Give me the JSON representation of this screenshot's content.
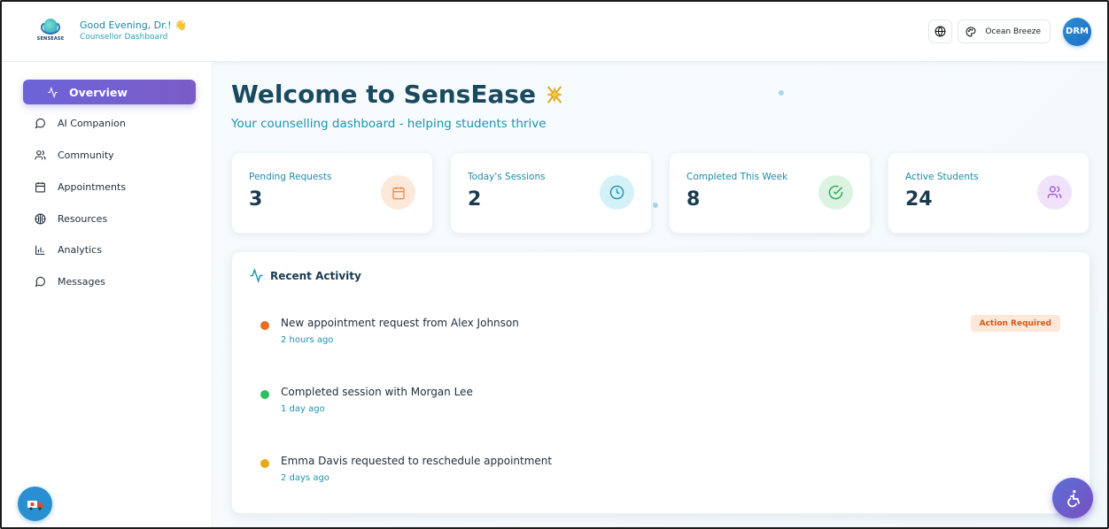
{
  "header": {
    "logo_text": "SENSEASE",
    "greeting": "Good Evening, Dr.! 👋",
    "subtitle": "Counsellor Dashboard",
    "theme_label": "Ocean Breeze",
    "avatar_initials": "DRM"
  },
  "sidebar": {
    "items": [
      {
        "label": "Overview",
        "icon": "activity-icon",
        "active": true
      },
      {
        "label": "AI Companion",
        "icon": "message-circle-icon"
      },
      {
        "label": "Community",
        "icon": "users-icon"
      },
      {
        "label": "Appointments",
        "icon": "calendar-icon"
      },
      {
        "label": "Resources",
        "icon": "globe-icon"
      },
      {
        "label": "Analytics",
        "icon": "bar-chart-icon"
      },
      {
        "label": "Messages",
        "icon": "message-circle-icon"
      }
    ]
  },
  "main": {
    "welcome_title": "Welcome to SensEase",
    "tagline": "Your counselling dashboard - helping students thrive",
    "stats": [
      {
        "label": "Pending Requests",
        "value": "3",
        "icon": "calendar-icon",
        "color": "#f08a4b",
        "bg": "#fde9da"
      },
      {
        "label": "Today's Sessions",
        "value": "2",
        "icon": "clock-icon",
        "color": "#1e93ad",
        "bg": "#d3f1f7"
      },
      {
        "label": "Completed This Week",
        "value": "8",
        "icon": "check-circle-icon",
        "color": "#2fa35a",
        "bg": "#dbf4e2"
      },
      {
        "label": "Active Students",
        "value": "24",
        "icon": "users-icon",
        "color": "#a45ad8",
        "bg": "#f1e2fb"
      }
    ],
    "activity": {
      "title": "Recent Activity",
      "action_label": "Action Required",
      "items": [
        {
          "text": "New appointment request from Alex Johnson",
          "time": "2 hours ago",
          "color": "#ee6a1e"
        },
        {
          "text": "Completed session with Morgan Lee",
          "time": "1 day ago",
          "color": "#2fbf5a"
        },
        {
          "text": "Emma Davis requested to reschedule appointment",
          "time": "2 days ago",
          "color": "#e9a81a"
        }
      ]
    }
  }
}
